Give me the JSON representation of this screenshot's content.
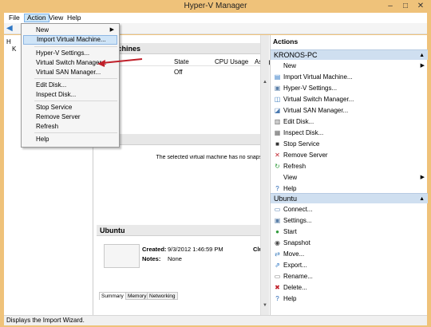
{
  "window": {
    "title": "Hyper-V Manager"
  },
  "caption_buttons": {
    "minimize": "–",
    "maximize": "□",
    "close": "✕"
  },
  "menubar": {
    "file": "File",
    "action": "Action",
    "view": "View",
    "help": "Help"
  },
  "tree": {
    "root": "H",
    "server": "K"
  },
  "action_menu": {
    "items": [
      {
        "label": "New",
        "submenu": true
      },
      {
        "label": "Import Virtual Machine..."
      },
      {
        "label": "Hyper-V Settings..."
      },
      {
        "label": "Virtual Switch Manager..."
      },
      {
        "label": "Virtual SAN Manager..."
      },
      {
        "label": "Edit Disk..."
      },
      {
        "label": "Inspect Disk..."
      },
      {
        "label": "Stop Service"
      },
      {
        "label": "Remove Server"
      },
      {
        "label": "Refresh"
      },
      {
        "label": "Help"
      }
    ]
  },
  "center": {
    "vm_header": "al Machines",
    "columns": {
      "name": "",
      "state": "State",
      "cpu": "CPU Usage",
      "assigned": "Assig"
    },
    "row": {
      "name": "ntu",
      "state": "Off"
    },
    "snapshots_header": "shots",
    "snapshots_text": "The selected virtual machine has no snapsho",
    "detail_header": "Ubuntu",
    "created_label": "Created:",
    "created_value": "9/3/2012 1:46:59 PM",
    "notes_label": "Notes:",
    "notes_value": "None",
    "clust_label": "Clust",
    "tabs": [
      "Summary",
      "Memory",
      "Networking"
    ]
  },
  "actions": {
    "header": "Actions",
    "group1": {
      "title": "KRONOS-PC",
      "items": [
        {
          "label": "New",
          "icon": "blank-icon",
          "submenu": true
        },
        {
          "label": "Import Virtual Machine...",
          "icon": "import-icon"
        },
        {
          "label": "Hyper-V Settings...",
          "icon": "settings-icon"
        },
        {
          "label": "Virtual Switch Manager...",
          "icon": "switch-icon"
        },
        {
          "label": "Virtual SAN Manager...",
          "icon": "san-icon"
        },
        {
          "label": "Edit Disk...",
          "icon": "edit-disk-icon"
        },
        {
          "label": "Inspect Disk...",
          "icon": "inspect-disk-icon"
        },
        {
          "label": "Stop Service",
          "icon": "stop-icon"
        },
        {
          "label": "Remove Server",
          "icon": "remove-icon"
        },
        {
          "label": "Refresh",
          "icon": "refresh-icon"
        },
        {
          "label": "View",
          "icon": "blank-icon",
          "submenu": true
        },
        {
          "label": "Help",
          "icon": "help-icon"
        }
      ]
    },
    "group2": {
      "title": "Ubuntu",
      "items": [
        {
          "label": "Connect...",
          "icon": "connect-icon"
        },
        {
          "label": "Settings...",
          "icon": "settings-icon"
        },
        {
          "label": "Start",
          "icon": "start-icon"
        },
        {
          "label": "Snapshot",
          "icon": "snapshot-icon"
        },
        {
          "label": "Move...",
          "icon": "move-icon"
        },
        {
          "label": "Export...",
          "icon": "export-icon"
        },
        {
          "label": "Rename...",
          "icon": "rename-icon"
        },
        {
          "label": "Delete...",
          "icon": "delete-icon"
        },
        {
          "label": "Help",
          "icon": "help-icon"
        }
      ]
    }
  },
  "status": {
    "text": "Displays the Import Wizard."
  },
  "colors": {
    "frame": "#efc27a",
    "accent": "#cfdff0",
    "highlight": "#cfe4f7",
    "arrow": "#c0202a"
  }
}
